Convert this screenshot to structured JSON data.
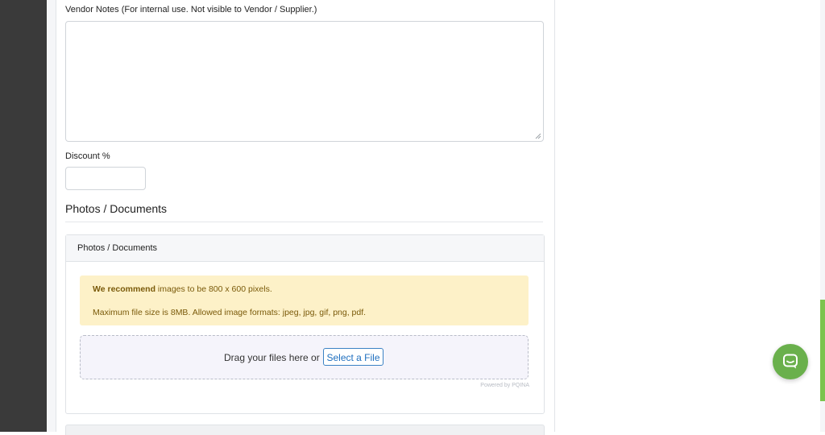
{
  "vendor_notes": {
    "label": "Vendor Notes (For internal use. Not visible to Vendor / Supplier.)",
    "value": ""
  },
  "discount": {
    "label": "Discount %",
    "value": ""
  },
  "photos_section": {
    "title": "Photos / Documents",
    "panel_header": "Photos / Documents",
    "alert": {
      "emphasis": "We recommend",
      "line1_rest": " images to be 800 x 600 pixels.",
      "line2": "Maximum file size is 8MB. Allowed image formats: jpeg, jpg, gif, png, pdf."
    },
    "dropzone": {
      "prompt": "Drag your files here or",
      "button_label": "Select a File",
      "powered_by": "Powered by PQINA"
    }
  },
  "chat": {
    "icon": "chat-icon",
    "color": "#6ab04c"
  }
}
